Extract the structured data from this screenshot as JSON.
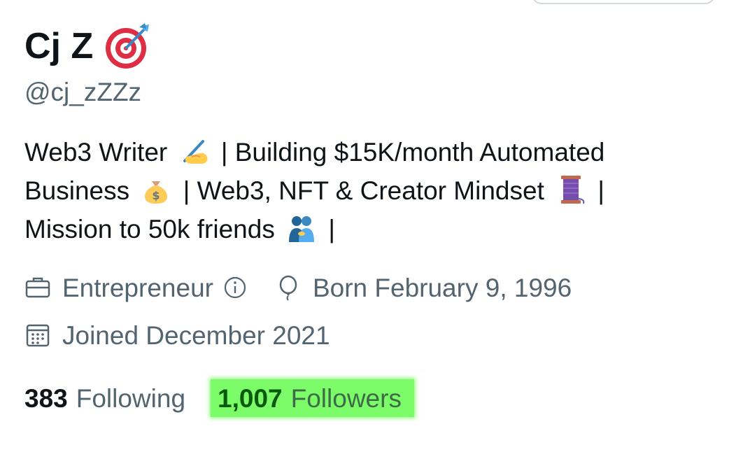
{
  "profile": {
    "display_name": "Cj Z",
    "display_name_emoji": "target-icon",
    "handle": "@cj_zZZz",
    "bio": {
      "line1_a": "Web3 Writer",
      "line1_emoji": "writing-hand-icon",
      "line1_b": "| Building $15K/month Automated",
      "line2_a": "Business",
      "line2_emoji": "money-bag-icon",
      "line2_b": "| Web3, NFT & Creator Mindset",
      "line2_emoji2": "thread-spool-icon",
      "line2_c": "|",
      "line3_a": "Mission to 50k friends",
      "line3_emoji": "people-hugging-icon",
      "line3_b": "|"
    },
    "category": "Entrepreneur",
    "birthday": "Born February 9, 1996",
    "joined": "Joined December 2021"
  },
  "stats": {
    "following_count": "383",
    "following_label": "Following",
    "followers_count": "1,007",
    "followers_label": "Followers"
  },
  "colors": {
    "text_primary": "#0f1419",
    "text_secondary": "#536471",
    "highlight": "#7dfc6a"
  }
}
